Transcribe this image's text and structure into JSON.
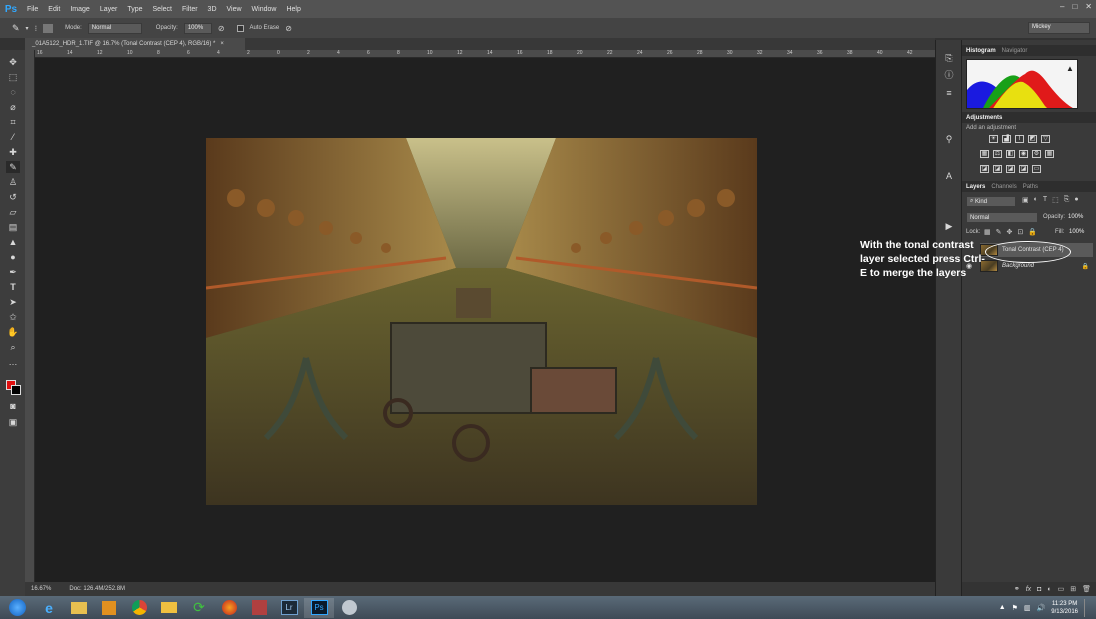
{
  "app": {
    "logo": "Ps"
  },
  "menu": [
    "File",
    "Edit",
    "Image",
    "Layer",
    "Type",
    "Select",
    "Filter",
    "3D",
    "View",
    "Window",
    "Help"
  ],
  "window_controls": [
    "–",
    "□",
    "✕"
  ],
  "options": {
    "mode_label": "Mode:",
    "mode_value": "Normal",
    "opacity_label": "Opacity:",
    "opacity_value": "100%",
    "auto_erase_label": "Auto Erase",
    "workspace": "Mickey"
  },
  "document": {
    "tab_title": "_01A5122_HDR_1.TIF @ 16.7% (Tonal Contrast (CEP 4), RGB/16) *",
    "ruler_ticks": [
      "16",
      "14",
      "12",
      "10",
      "8",
      "6",
      "4",
      "2",
      "0",
      "2",
      "4",
      "6",
      "8",
      "10",
      "12",
      "14",
      "16",
      "18",
      "20",
      "22",
      "24",
      "26",
      "28",
      "30",
      "32",
      "34",
      "36",
      "38",
      "40",
      "42"
    ]
  },
  "status": {
    "zoom": "16.67%",
    "doc": "Doc: 126.4M/252.8M"
  },
  "panels": {
    "histogram_tabs": [
      "Histogram",
      "Navigator"
    ],
    "adjustments_title": "Adjustments",
    "add_adjustment": "Add an adjustment",
    "layers_tabs": [
      "Layers",
      "Channels",
      "Paths"
    ],
    "kind_label": "Kind",
    "blend_mode": "Normal",
    "opacity_label": "Opacity:",
    "opacity_value": "100%",
    "lock_label": "Lock:",
    "fill_label": "Fill:",
    "fill_value": "100%",
    "layers": [
      {
        "name": "Tonal Contrast (CEP 4)",
        "selected": true
      },
      {
        "name": "Background",
        "selected": false
      }
    ]
  },
  "annotation": "With the tonal contrast layer selected press Ctrl-E to merge the layers",
  "taskbar": {
    "time": "11:23 PM",
    "date": "9/13/2016"
  },
  "colors": {
    "foreground": "#e01010",
    "background": "#000000",
    "accent": "#31a8ff"
  }
}
